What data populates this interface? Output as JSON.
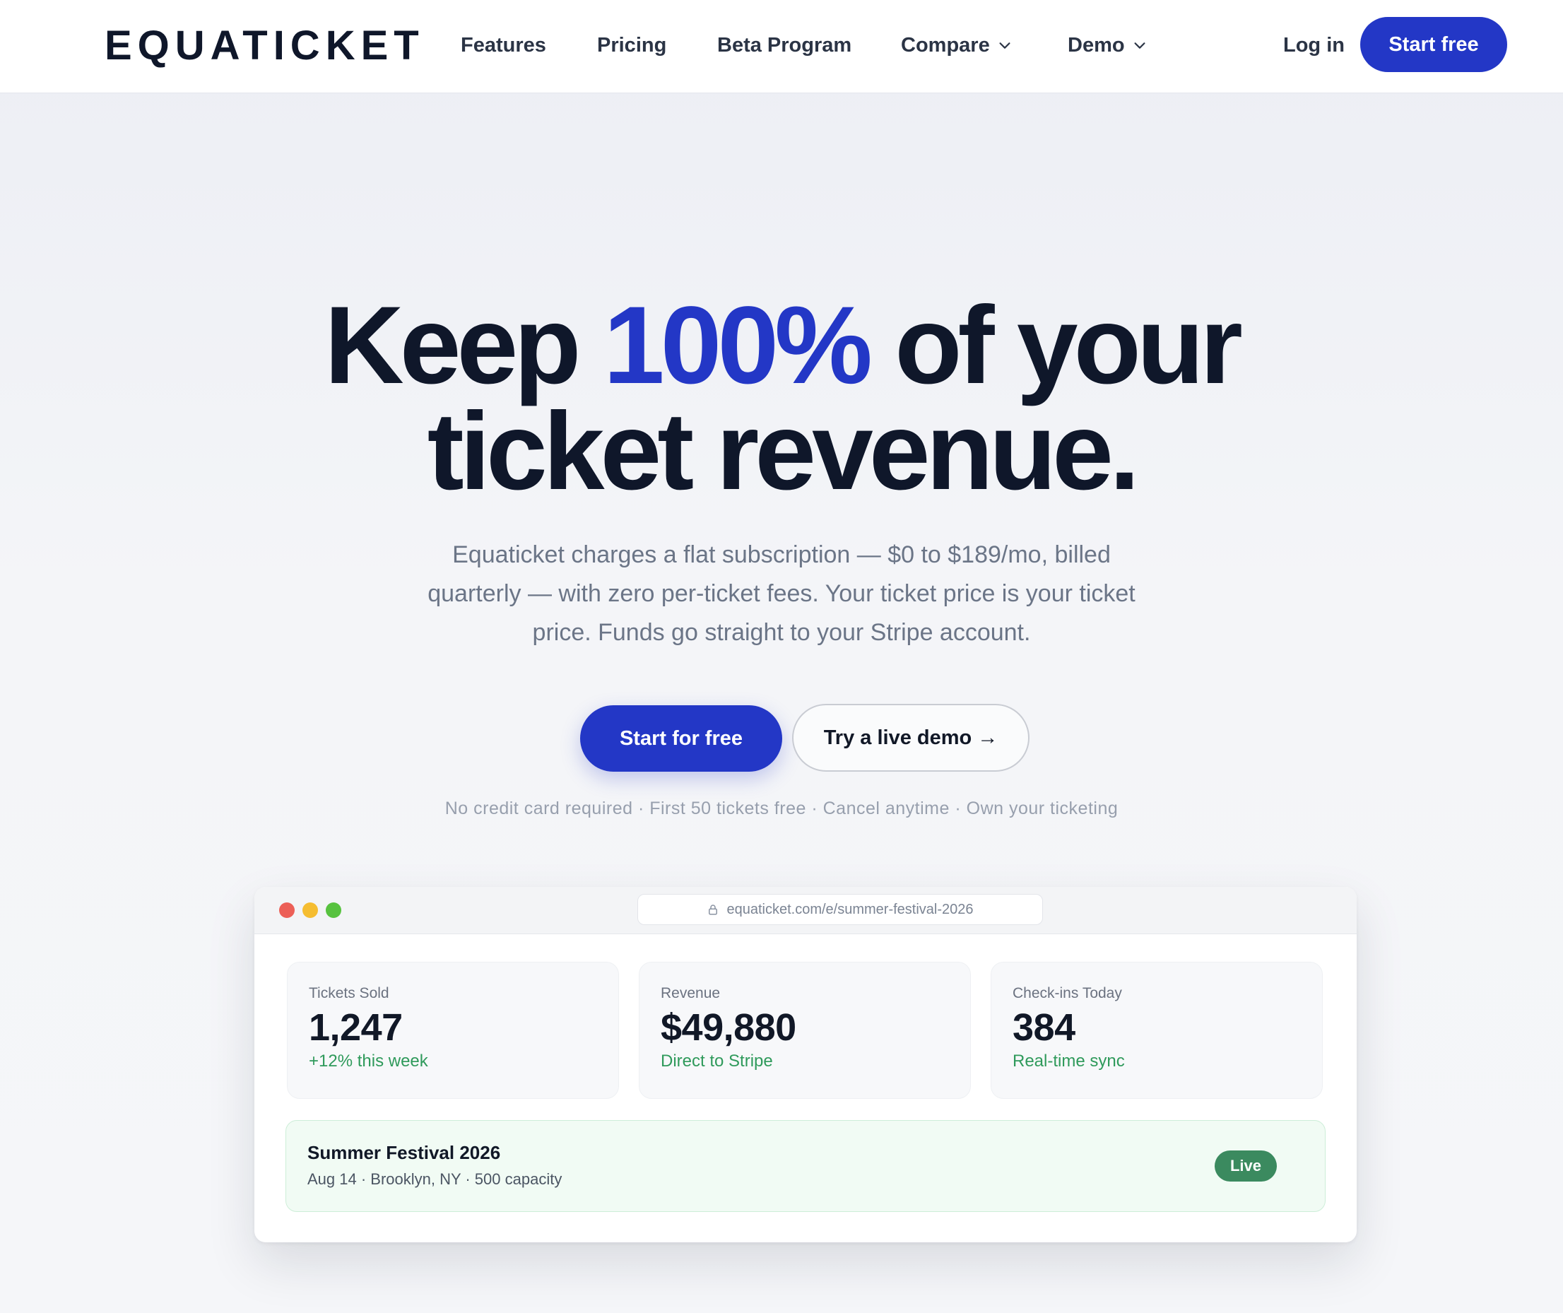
{
  "nav": {
    "logo": "EQUATICKET",
    "links": [
      "Features",
      "Pricing",
      "Beta Program",
      "Compare",
      "Demo"
    ],
    "login": "Log in",
    "cta": "Start free"
  },
  "hero": {
    "title_part1": "Keep ",
    "title_accent": "100%",
    "title_part2": " of your",
    "title_line2": "ticket revenue.",
    "subtitle": "Equaticket charges a flat subscription — $0 to $189/mo, billed quarterly — with zero per-ticket fees. Your ticket price is your ticket price. Funds go straight to your Stripe account.",
    "primary_cta": "Start for free",
    "secondary_cta": "Try a live demo →",
    "fineprint": "No credit card required · First 50 tickets free · Cancel anytime · Own your ticketing"
  },
  "browser": {
    "url": "equaticket.com/e/summer-festival-2026",
    "dot_colors": [
      "#ec5f57",
      "#f5bd31",
      "#57c23f"
    ],
    "stats": [
      {
        "label": "Tickets Sold",
        "value": "1,247",
        "note": "+12% this week"
      },
      {
        "label": "Revenue",
        "value": "$49,880",
        "note": "Direct to Stripe"
      },
      {
        "label": "Check-ins Today",
        "value": "384",
        "note": "Real-time sync"
      }
    ],
    "event": {
      "name": "Summer Festival 2026",
      "meta": "Aug 14 · Brooklyn, NY · 500 capacity",
      "badge": "Live"
    }
  },
  "colors": {
    "accent": "#2337c6",
    "success": "#2f9a5b",
    "badge": "#3b8a5f"
  }
}
